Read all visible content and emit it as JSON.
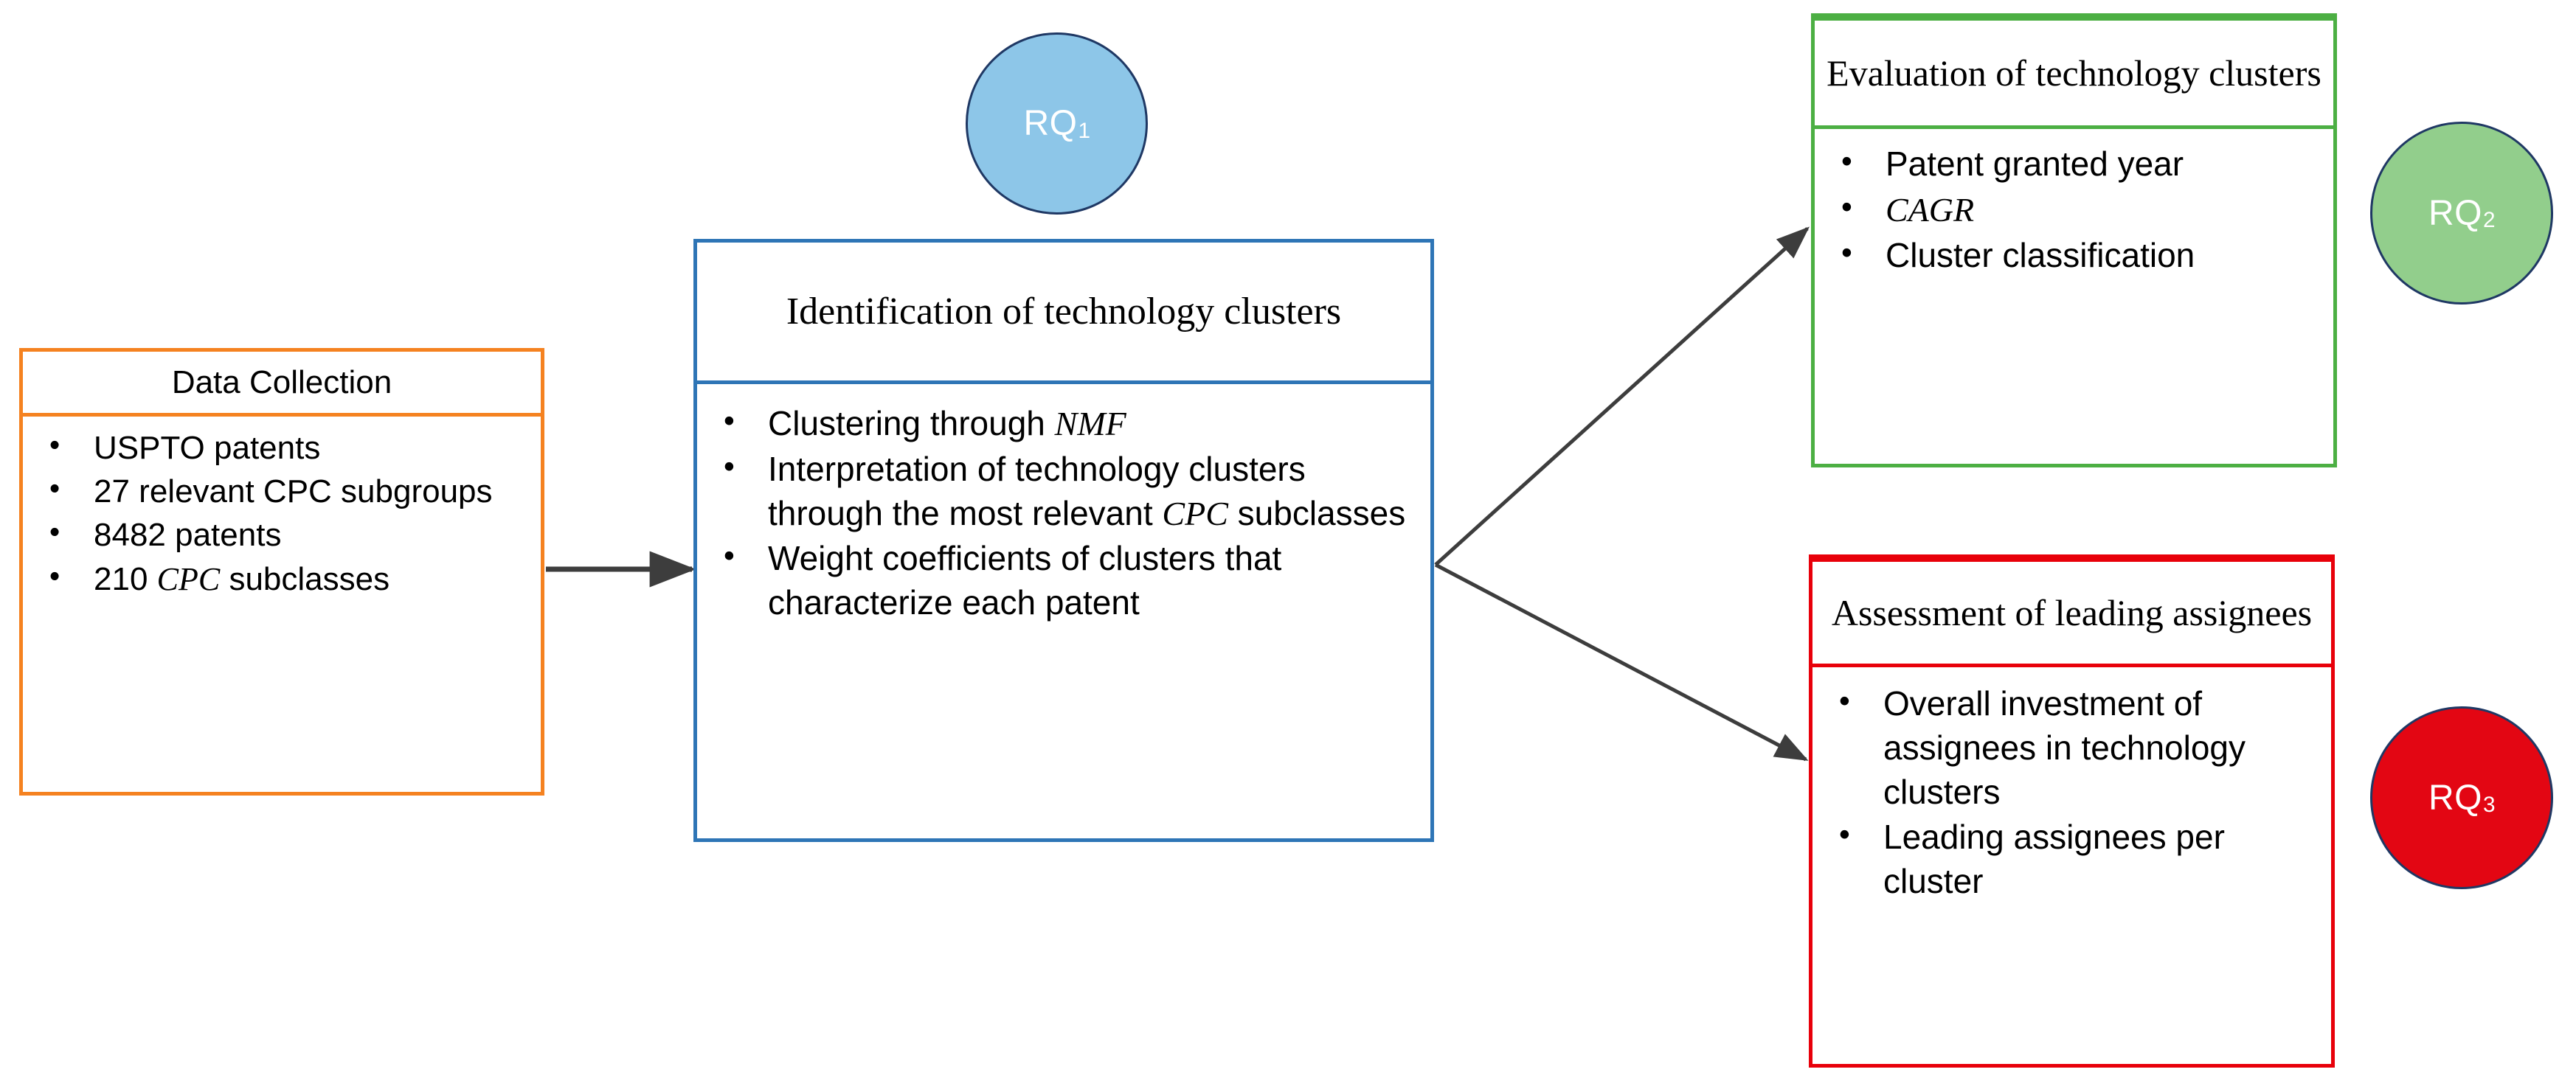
{
  "diagram": {
    "title_alt": "Research framework flow diagram",
    "colors": {
      "data_collection_border": "#F58220",
      "identification_border": "#2E75B6",
      "evaluation_border": "#4CAF43",
      "assessment_border": "#E8000A",
      "rq1_fill": "#8DC6E8",
      "rq2_fill": "#92CE8C",
      "rq3_fill": "#E30613",
      "circle_border": "#1F3864",
      "arrow": "#404040"
    }
  },
  "boxes": {
    "data_collection": {
      "title": "Data Collection",
      "bullets": [
        {
          "pre": "USPTO patents",
          "italic": "",
          "post": ""
        },
        {
          "pre": "27 relevant CPC subgroups",
          "italic": "",
          "post": ""
        },
        {
          "pre": "8482 patents",
          "italic": "",
          "post": ""
        },
        {
          "pre": "210 ",
          "italic": "CPC",
          "post": " subclasses"
        }
      ]
    },
    "identification": {
      "title": "Identification of technology clusters",
      "bullets": [
        {
          "pre": "Clustering through ",
          "italic": "NMF",
          "post": ""
        },
        {
          "pre": "Interpretation of technology clusters through the most relevant ",
          "italic": "CPC",
          "post": " subclasses"
        },
        {
          "pre": "Weight coefficients of clusters that characterize each patent",
          "italic": "",
          "post": ""
        }
      ]
    },
    "evaluation": {
      "title": "Evaluation of technology clusters",
      "bullets": [
        {
          "pre": "Patent granted year",
          "italic": "",
          "post": ""
        },
        {
          "pre": "",
          "italic": "CAGR",
          "post": ""
        },
        {
          "pre": "Cluster classification",
          "italic": "",
          "post": ""
        }
      ]
    },
    "assessment": {
      "title": "Assessment of leading assignees",
      "bullets": [
        {
          "pre": "Overall investment of assignees in technology clusters",
          "italic": "",
          "post": ""
        },
        {
          "pre": "Leading assignees per cluster",
          "italic": "",
          "post": ""
        }
      ]
    }
  },
  "circles": [
    {
      "label": "RQ",
      "subscript": "1"
    },
    {
      "label": "RQ",
      "subscript": "2"
    },
    {
      "label": "RQ",
      "subscript": "3"
    }
  ]
}
